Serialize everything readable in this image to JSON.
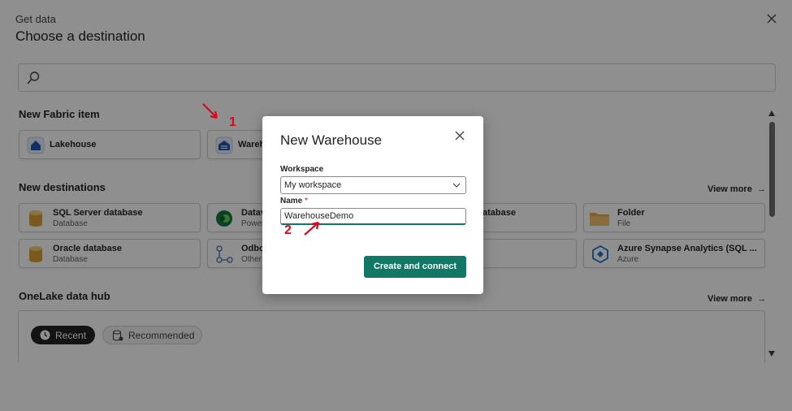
{
  "header": {
    "subtitle": "Get data",
    "title": "Choose a destination"
  },
  "search": {
    "placeholder": ""
  },
  "sections": {
    "new_fabric": "New Fabric item",
    "new_destinations": "New destinations",
    "onelake": "OneLake data hub"
  },
  "fabric_items": [
    {
      "label": "Lakehouse"
    },
    {
      "label": "Wareh"
    }
  ],
  "destinations": [
    {
      "label": "SQL Server database",
      "sub": "Database"
    },
    {
      "label": "Datav",
      "sub": "Power"
    },
    {
      "label": "atabase",
      "sub": ""
    },
    {
      "label": "Folder",
      "sub": "File"
    },
    {
      "label": "Oracle database",
      "sub": "Database"
    },
    {
      "label": "Odbc",
      "sub": "Other"
    },
    {
      "label": "Azure Synapse Analytics (SQL ...",
      "sub": "Azure"
    }
  ],
  "view_more": "View more",
  "hub_tabs": {
    "recent": "Recent",
    "recommended": "Recommended"
  },
  "modal": {
    "title": "New Warehouse",
    "workspace_label": "Workspace",
    "workspace_value": "My workspace",
    "name_label": "Name",
    "required_mark": "*",
    "name_value": "WarehouseDemo",
    "submit": "Create and connect"
  },
  "annotations": {
    "step1": "1",
    "step2": "2"
  },
  "colors": {
    "accent": "#117865",
    "annotation": "#e3001b"
  }
}
